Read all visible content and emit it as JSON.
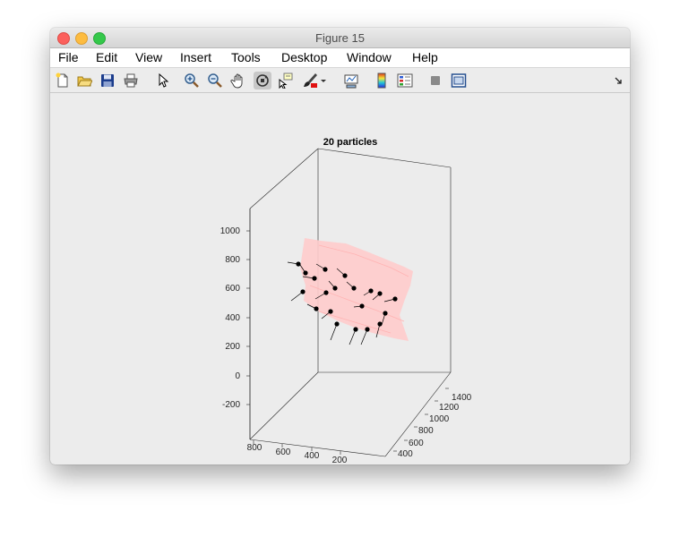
{
  "window": {
    "title": "Figure 15"
  },
  "menu": [
    "File",
    "Edit",
    "View",
    "Insert",
    "Tools",
    "Desktop",
    "Window",
    "Help"
  ],
  "toolbar": [
    {
      "name": "new-figure-icon",
      "active": false
    },
    {
      "name": "open-file-icon",
      "active": false
    },
    {
      "name": "save-icon",
      "active": false
    },
    {
      "name": "print-icon",
      "active": false
    },
    {
      "name": "pointer-icon",
      "active": false
    },
    {
      "name": "zoom-in-icon",
      "active": false
    },
    {
      "name": "zoom-out-icon",
      "active": false
    },
    {
      "name": "pan-hand-icon",
      "active": false
    },
    {
      "name": "rotate-3d-icon",
      "active": true
    },
    {
      "name": "data-cursor-icon",
      "active": false
    },
    {
      "name": "brush-icon",
      "active": false
    },
    {
      "name": "brush-dropdown-icon",
      "active": false
    },
    {
      "name": "link-plot-icon",
      "active": false
    },
    {
      "name": "colorbar-icon",
      "active": false
    },
    {
      "name": "legend-icon",
      "active": false
    },
    {
      "name": "hide-plot-tools-icon",
      "active": false
    },
    {
      "name": "show-plot-tools-icon",
      "active": false
    },
    {
      "name": "dock-arrow-icon",
      "active": false
    }
  ],
  "chart_data": {
    "type": "scatter",
    "title": "20 particles",
    "zticks": [
      "-200",
      "0",
      "200",
      "400",
      "600",
      "800",
      "1000"
    ],
    "xticks": [
      "800",
      "600",
      "400",
      "200"
    ],
    "yticks": [
      "400",
      "600",
      "800",
      "1000",
      "1200",
      "1400"
    ],
    "grid": false,
    "surface_color": "#ffcccc",
    "marker_color": "#000000"
  }
}
